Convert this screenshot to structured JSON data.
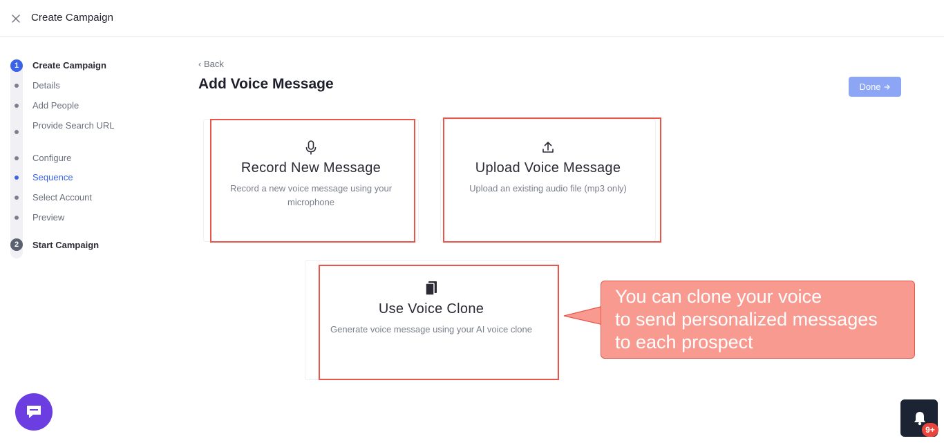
{
  "header": {
    "title": "Create Campaign"
  },
  "stepper": {
    "step1": {
      "number": "1",
      "title": "Create Campaign"
    },
    "items": [
      {
        "label": "Details"
      },
      {
        "label": "Add People"
      },
      {
        "label": "Provide Search URL"
      },
      {
        "label": "Configure"
      },
      {
        "label": "Sequence"
      },
      {
        "label": "Select Account"
      },
      {
        "label": "Preview"
      }
    ],
    "step2": {
      "number": "2",
      "title": "Start Campaign"
    }
  },
  "main": {
    "back_label": "Back",
    "title": "Add Voice Message",
    "done_label": "Done",
    "cards": [
      {
        "title": "Record New Message",
        "desc": "Record a new voice message using your microphone",
        "icon": "microphone-icon"
      },
      {
        "title": "Upload Voice Message",
        "desc": "Upload an existing audio file (mp3 only)",
        "icon": "upload-icon"
      },
      {
        "title": "Use Voice Clone",
        "desc": "Generate voice message using your AI voice clone",
        "icon": "voice-clone-icon"
      }
    ]
  },
  "callout": {
    "line1": "You can clone your voice",
    "line2": "to send personalized messages",
    "line3": "to each prospect"
  },
  "notifications": {
    "badge": "9+"
  },
  "colors": {
    "accent": "#3b63e6",
    "highlight": "#e8564a",
    "callout_bg": "#f99a90",
    "chat": "#6c3de0"
  }
}
